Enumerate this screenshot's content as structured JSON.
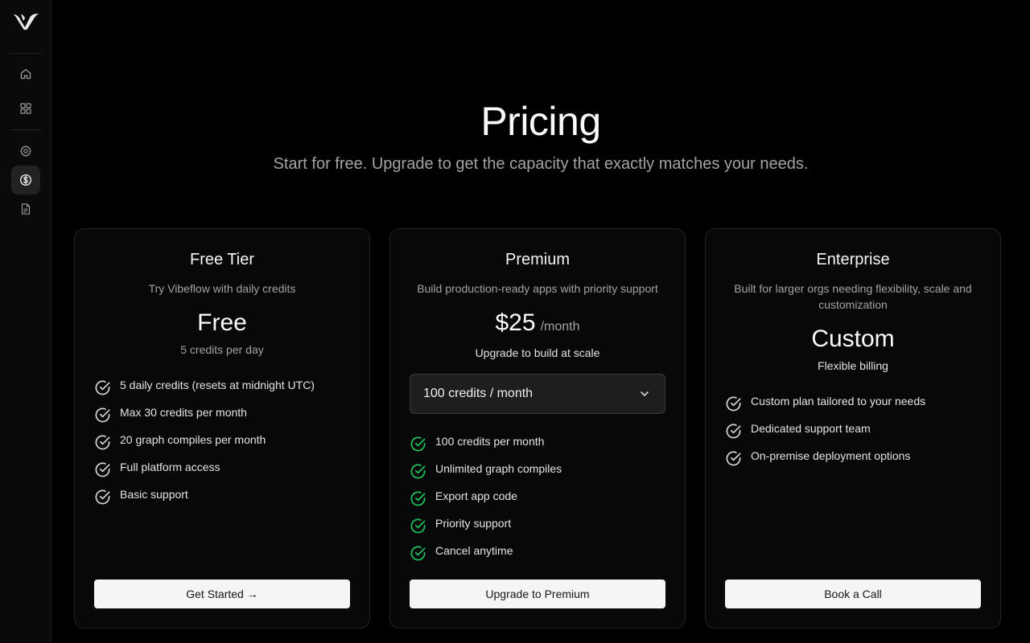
{
  "page": {
    "title": "Pricing",
    "subtitle": "Start for free. Upgrade to get the capacity that exactly matches your needs."
  },
  "sidebar": {
    "items": [
      {
        "name": "home",
        "icon": "home-icon",
        "active": false
      },
      {
        "name": "apps",
        "icon": "grid-icon",
        "active": false
      },
      {
        "name": "settings",
        "icon": "gear-icon",
        "active": false
      },
      {
        "name": "pricing",
        "icon": "dollar-icon",
        "active": true
      },
      {
        "name": "docs",
        "icon": "document-icon",
        "active": false
      }
    ]
  },
  "plans": {
    "free": {
      "name": "Free Tier",
      "description": "Try Vibeflow with daily credits",
      "price": "Free",
      "price_note": "5 credits per day",
      "features": [
        "5 daily credits (resets at midnight UTC)",
        "Max 30 credits per month",
        "20 graph compiles per month",
        "Full platform access",
        "Basic support"
      ],
      "cta": "Get Started →"
    },
    "premium": {
      "name": "Premium",
      "description": "Build production-ready apps with priority support",
      "price": "$25",
      "price_unit": "/month",
      "price_note": "Upgrade to build at scale",
      "credits_select": "100 credits / month",
      "features": [
        "100 credits per month",
        "Unlimited graph compiles",
        "Export app code",
        "Priority support",
        "Cancel anytime"
      ],
      "cta": "Upgrade to Premium"
    },
    "enterprise": {
      "name": "Enterprise",
      "description": "Built for larger orgs needing flexibility, scale and customization",
      "price": "Custom",
      "price_note": "Flexible billing",
      "features": [
        "Custom plan tailored to your needs",
        "Dedicated support team",
        "On-premise deployment options"
      ],
      "cta": "Book a Call"
    }
  },
  "colors": {
    "background": "#000000",
    "card_background": "#070809",
    "check_default": "#d4d4d4",
    "check_premium": "#22c55e",
    "button_background": "#f5f5f5"
  }
}
